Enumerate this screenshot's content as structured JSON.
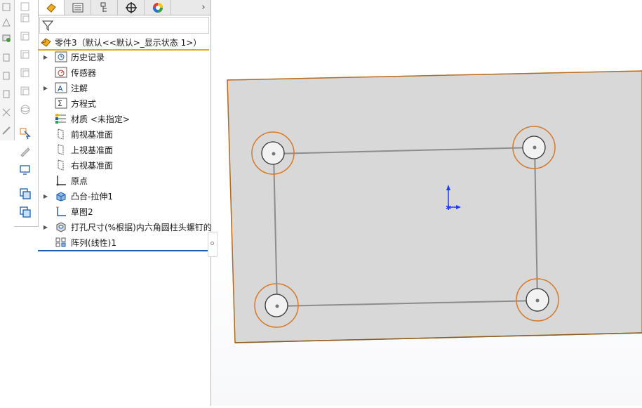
{
  "tabs": [
    {
      "name": "featuremanager-tab",
      "icon": "feature-manager-icon",
      "active": true
    },
    {
      "name": "propertymanager-tab",
      "icon": "property-manager-icon",
      "active": false
    },
    {
      "name": "configurationmanager-tab",
      "icon": "configuration-manager-icon",
      "active": false
    },
    {
      "name": "dimxpert-tab",
      "icon": "crosshair-icon",
      "active": false
    },
    {
      "name": "display-manager-tab",
      "icon": "color-wheel-icon",
      "active": false
    }
  ],
  "tab_more": "›",
  "tree": {
    "root_label": "零件3（默认<<默认>_显示状态 1>）",
    "items": [
      {
        "label": "历史记录",
        "icon": "history-icon",
        "expandable": true
      },
      {
        "label": "传感器",
        "icon": "sensor-icon",
        "expandable": false
      },
      {
        "label": "注解",
        "icon": "annotation-icon",
        "expandable": true
      },
      {
        "label": "方程式",
        "icon": "equation-icon",
        "expandable": false
      },
      {
        "label": "材质 <未指定>",
        "icon": "material-icon",
        "expandable": false
      },
      {
        "label": "前视基准面",
        "icon": "plane-icon",
        "expandable": false
      },
      {
        "label": "上视基准面",
        "icon": "plane-icon",
        "expandable": false
      },
      {
        "label": "右视基准面",
        "icon": "plane-icon",
        "expandable": false
      },
      {
        "label": "原点",
        "icon": "origin-icon",
        "expandable": false
      },
      {
        "label": "凸台-拉伸1",
        "icon": "extrude-icon",
        "expandable": true
      },
      {
        "label": "草图2",
        "icon": "sketch-icon",
        "expandable": false
      },
      {
        "label": "打孔尺寸(%根据)内六角圆柱头螺钉的",
        "icon": "hole-wizard-icon",
        "expandable": true
      },
      {
        "label": "阵列(线性)1",
        "icon": "linear-pattern-icon",
        "expandable": false
      }
    ]
  },
  "colors": {
    "accent": "#e1a81e",
    "selection_line": "#1d5fa8",
    "face_fill": "#d8d8d8",
    "edge": "#c87a1e",
    "sketch_line": "#8c8c8c",
    "hole_silhouette": "#d47a2a",
    "triad_blue": "#1a3cff"
  }
}
